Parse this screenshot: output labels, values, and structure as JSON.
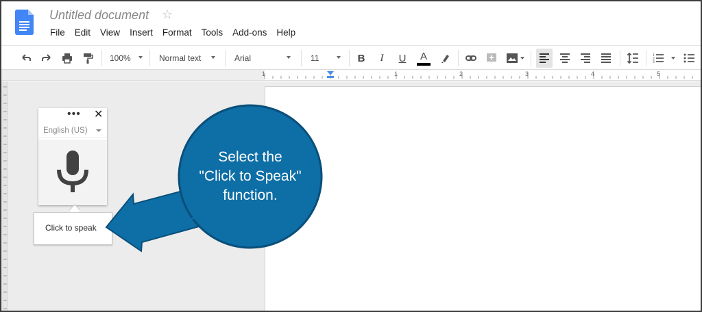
{
  "document": {
    "title": "Untitled document"
  },
  "menu": [
    "File",
    "Edit",
    "View",
    "Insert",
    "Format",
    "Tools",
    "Add-ons",
    "Help"
  ],
  "toolbar": {
    "zoom": "100%",
    "style": "Normal text",
    "font": "Arial",
    "font_size": "11",
    "bold": "B",
    "italic": "I",
    "underline": "U",
    "text_color_letter": "A"
  },
  "ruler": {
    "numbers": [
      "1",
      "1",
      "2",
      "3",
      "4",
      "5"
    ]
  },
  "voice_typing": {
    "language": "English (US)",
    "menu_glyph": "•••",
    "close_glyph": "✕",
    "tooltip": "Click to speak"
  },
  "callout": {
    "line1": "Select the",
    "line2": "\"Click to Speak\"",
    "line3": "function."
  },
  "colors": {
    "doc_icon": "#4285f4",
    "callout_fill": "#0e6ea6",
    "callout_stroke": "#0a4f7a",
    "ruler_indent": "#4a8ee8"
  },
  "icons": {
    "undo": "undo-icon",
    "redo": "redo-icon",
    "print": "print-icon",
    "paint_format": "paint-format-icon",
    "highlight": "highlight-icon",
    "link": "link-icon",
    "comment": "add-comment-icon",
    "image": "image-icon",
    "align_left": "align-left-icon",
    "align_center": "align-center-icon",
    "align_right": "align-right-icon",
    "justify": "justify-icon",
    "line_spacing": "line-spacing-icon",
    "numbered_list": "numbered-list-icon",
    "bulleted_list": "bulleted-list-icon",
    "microphone": "microphone-icon"
  }
}
